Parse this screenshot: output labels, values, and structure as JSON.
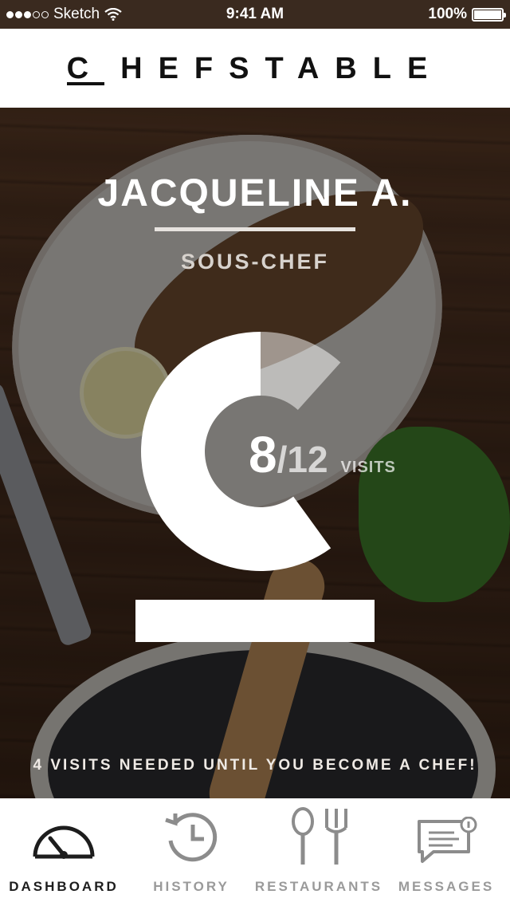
{
  "status_bar": {
    "carrier": "Sketch",
    "time": "9:41 AM",
    "battery": "100%",
    "signal_bars_filled": 3,
    "signal_bars_total": 5
  },
  "header": {
    "logo_c": "C",
    "logo_rest": "HEFSTABLE"
  },
  "profile": {
    "name": "JACQUELINE A.",
    "role": "SOUS-CHEF"
  },
  "progress": {
    "visits": "8",
    "total": "/12",
    "unit": "VISITS",
    "fraction": 0.6667,
    "needed_message": "4 VISITS NEEDED UNTIL YOU BECOME A CHEF!"
  },
  "tabs": [
    {
      "label": "DASHBOARD",
      "icon": "speedometer-icon",
      "active": true
    },
    {
      "label": "HISTORY",
      "icon": "history-clock-icon",
      "active": false
    },
    {
      "label": "RESTAURANTS",
      "icon": "fork-spoon-icon",
      "active": false
    },
    {
      "label": "MESSAGES",
      "icon": "message-badge-icon",
      "active": false
    }
  ],
  "colors": {
    "accent": "#ffffff",
    "active_tab": "#1d1d1d",
    "inactive_tab": "#9a9a9a"
  }
}
